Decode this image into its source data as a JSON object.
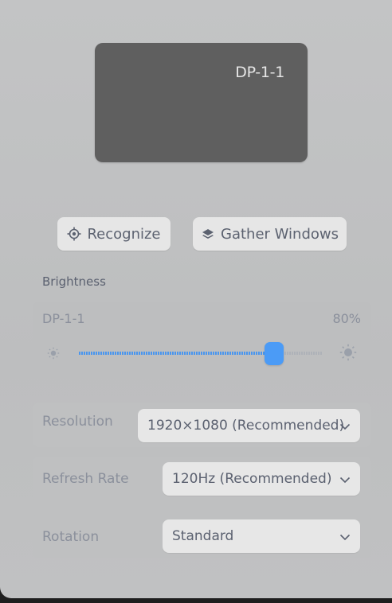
{
  "monitor": {
    "label": "DP-1-1"
  },
  "actions": {
    "recognize_label": "Recognize",
    "gather_label": "Gather Windows"
  },
  "brightness": {
    "title": "Brightness",
    "display_name": "DP-1-1",
    "value_text": "80%",
    "value": 0.8
  },
  "settings": {
    "resolution": {
      "label": "Resolution",
      "value": "1920×1080 (Recommended)"
    },
    "refresh_rate": {
      "label": "Refresh Rate",
      "value": "120Hz (Recommended)"
    },
    "rotation": {
      "label": "Rotation",
      "value": "Standard"
    }
  },
  "colors": {
    "accent": "#4b9bf6",
    "panel": "#c3c4c5",
    "monitor": "#5f5f5f"
  },
  "icons": [
    "target-icon",
    "layers-icon",
    "sun-low-icon",
    "sun-high-icon",
    "chevron-down-icon"
  ]
}
